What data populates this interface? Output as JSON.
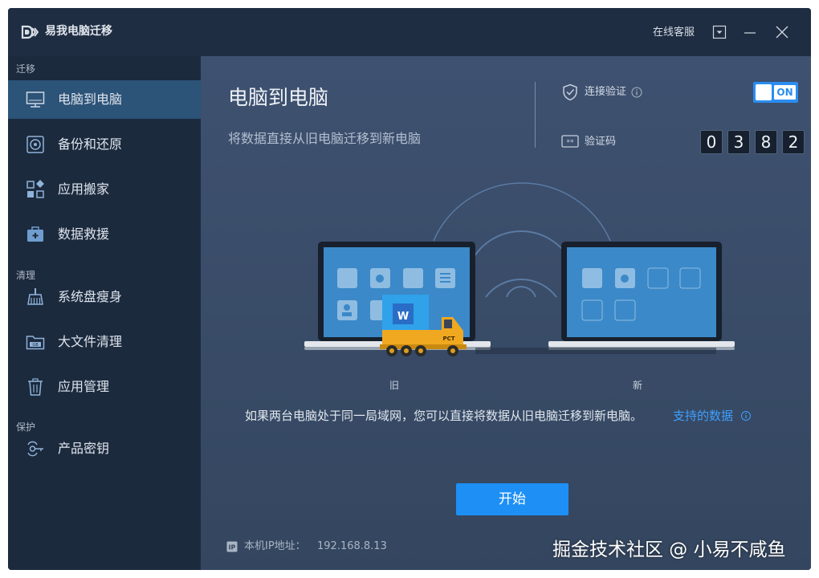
{
  "app": {
    "title": "易我电脑迁移",
    "support_label": "在线客服"
  },
  "sidebar": {
    "sections": [
      {
        "label": "迁移"
      },
      {
        "label": "清理"
      },
      {
        "label": "保护"
      }
    ],
    "items": [
      {
        "label": "电脑到电脑",
        "icon": "monitor-icon",
        "active": true
      },
      {
        "label": "备份和还原",
        "icon": "backup-icon"
      },
      {
        "label": "应用搬家",
        "icon": "apps-icon"
      },
      {
        "label": "数据救援",
        "icon": "rescue-kit-icon"
      },
      {
        "label": "系统盘瘦身",
        "icon": "broom-icon"
      },
      {
        "label": "大文件清理",
        "icon": "folder-gb-icon"
      },
      {
        "label": "应用管理",
        "icon": "trash-icon"
      },
      {
        "label": "产品密钥",
        "icon": "key-icon"
      }
    ]
  },
  "main": {
    "title": "电脑到电脑",
    "subtitle": "将数据直接从旧电脑迁移到新电脑",
    "connection": {
      "label": "连接验证",
      "toggle_state": "ON"
    },
    "verification": {
      "label": "验证码",
      "digits": [
        "0",
        "3",
        "8",
        "2"
      ]
    },
    "illustration": {
      "old_label": "旧",
      "new_label": "新",
      "truck_label": "PCT"
    },
    "description": "如果两台电脑处于同一局域网，您可以直接将数据从旧电脑迁移到新电脑。",
    "support_link": "支持的数据",
    "start_button": "开始",
    "ip": {
      "label": "本机IP地址：",
      "value": "192.168.8.13"
    }
  },
  "watermark": "掘金技术社区 @ 小易不咸鱼",
  "colors": {
    "accent": "#1e90f5",
    "link": "#3ea0ff",
    "sidebar_bg": "#1c2a3e",
    "active_item": "#2c5378",
    "titlebar_bg": "#1e2d42"
  }
}
